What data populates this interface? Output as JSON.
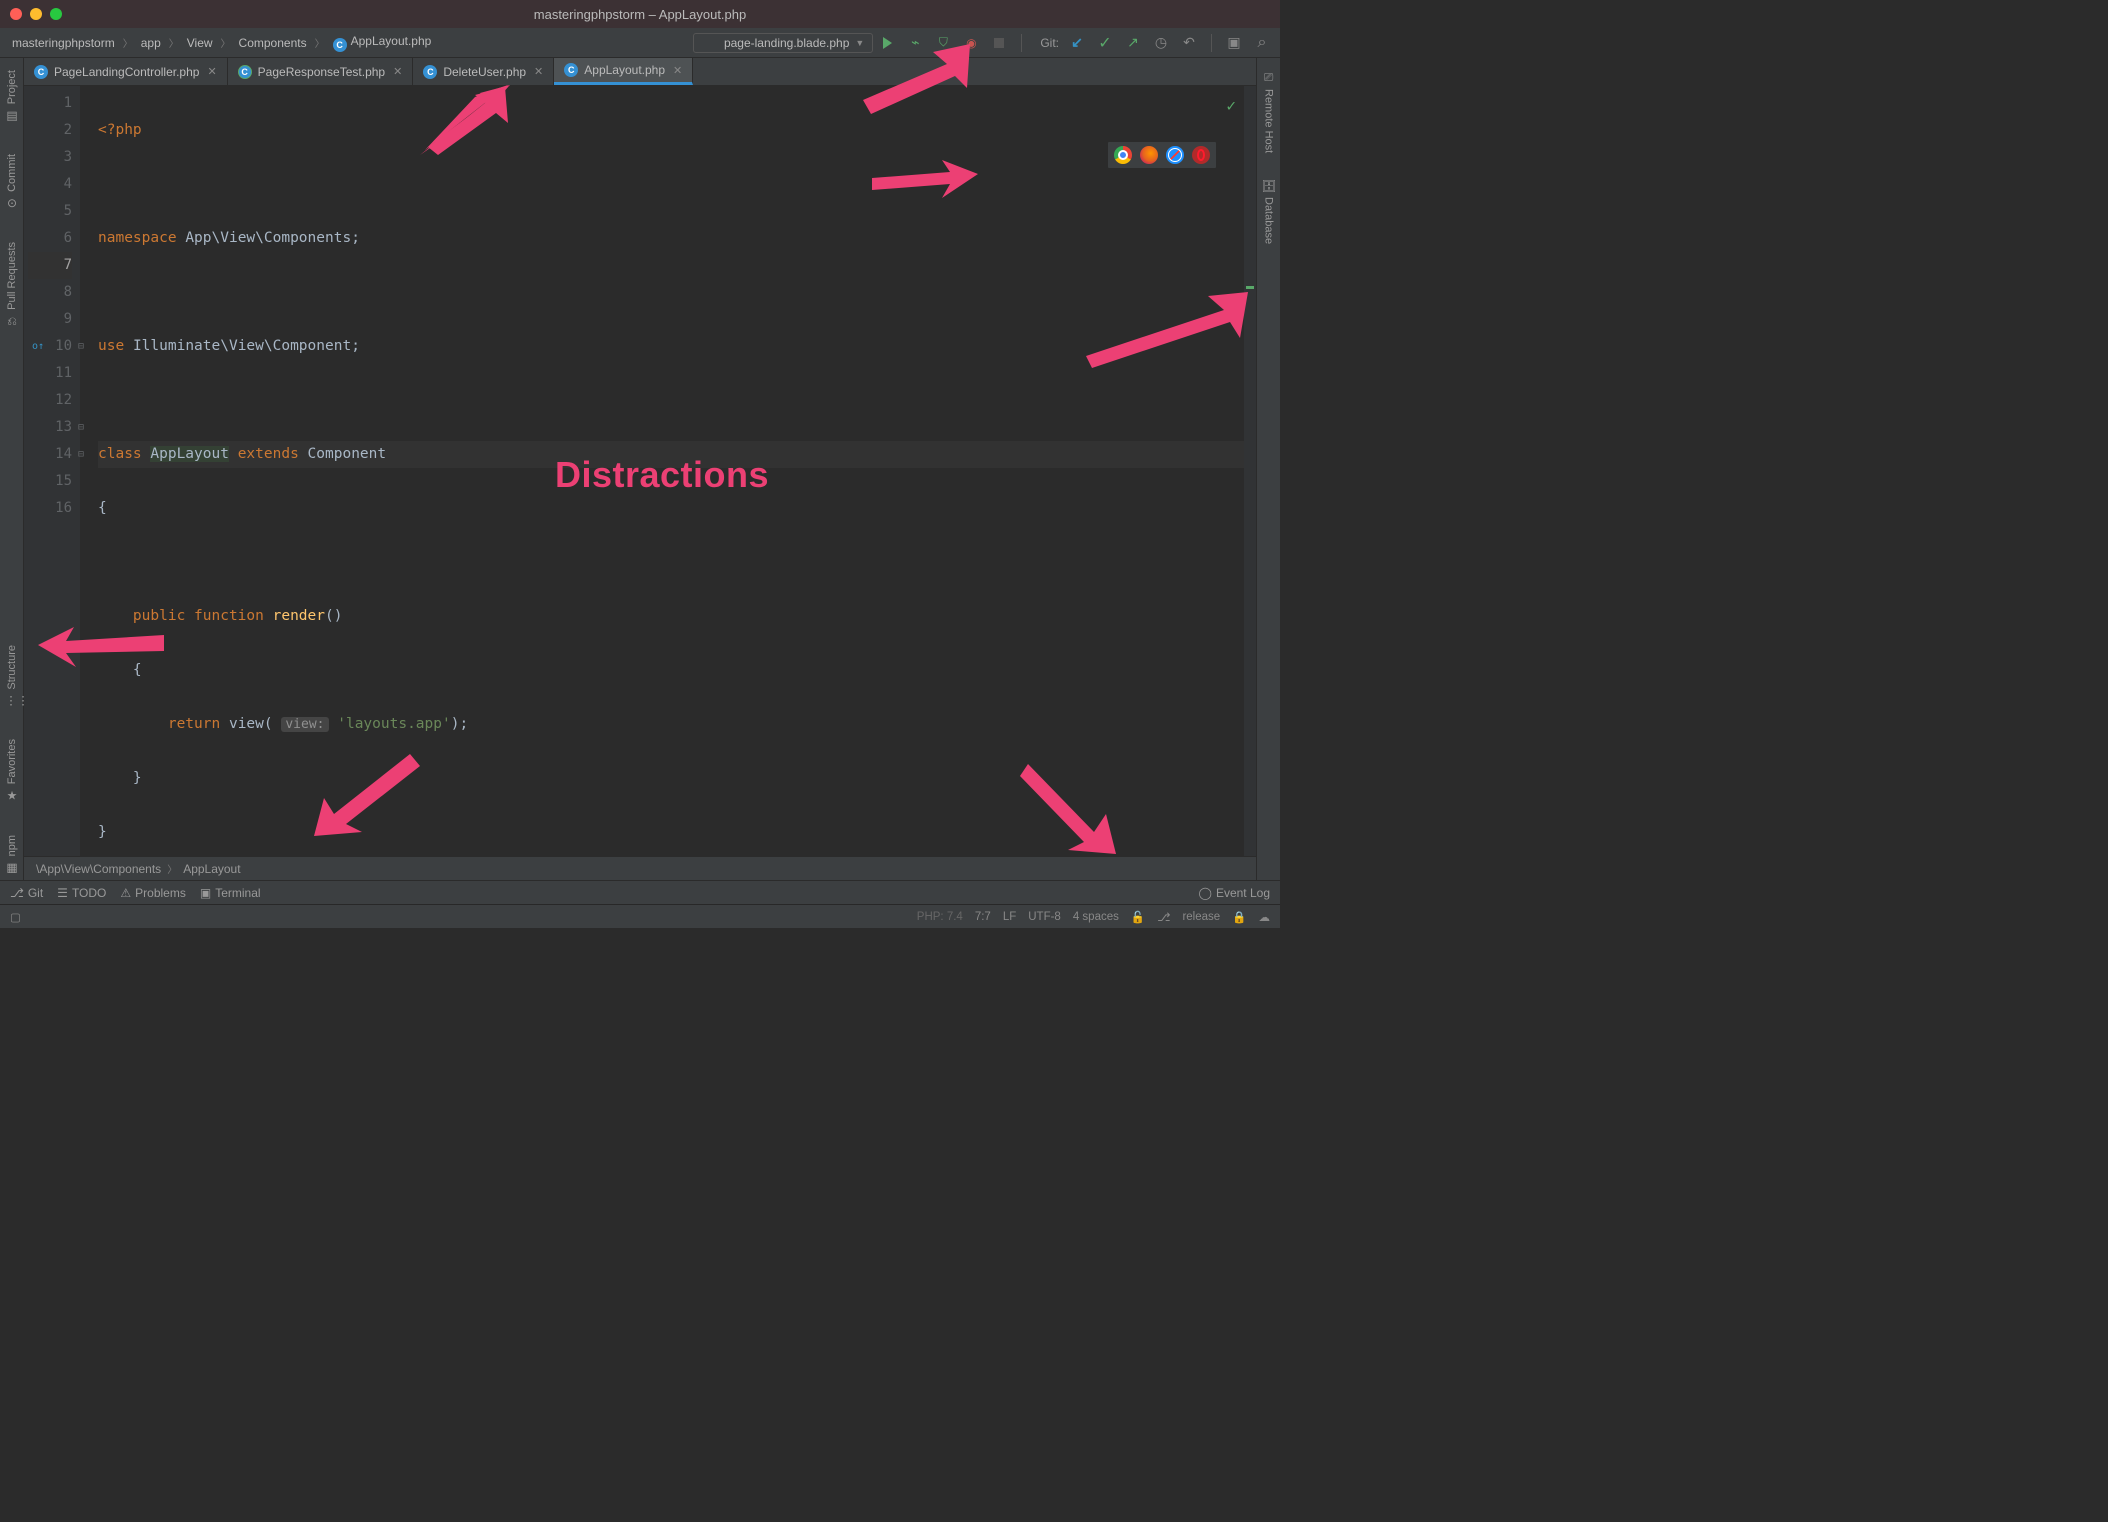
{
  "window": {
    "title": "masteringphpstorm – AppLayout.php"
  },
  "breadcrumbs": {
    "project": "masteringphpstorm",
    "path1": "app",
    "path2": "View",
    "path3": "Components",
    "file": "AppLayout.php"
  },
  "run_config": {
    "selected": "page-landing.blade.php"
  },
  "git_label": "Git:",
  "tabs": [
    {
      "label": "PageLandingController.php",
      "active": false,
      "test": false
    },
    {
      "label": "PageResponseTest.php",
      "active": false,
      "test": true
    },
    {
      "label": "DeleteUser.php",
      "active": false,
      "test": false
    },
    {
      "label": "AppLayout.php",
      "active": true,
      "test": false
    }
  ],
  "left_rail": {
    "project": "Project",
    "commit": "Commit",
    "pull": "Pull Requests",
    "structure": "Structure",
    "favorites": "Favorites",
    "npm": "npm"
  },
  "right_rail": {
    "remote": "Remote Host",
    "database": "Database"
  },
  "code": {
    "l1a": "<?php",
    "l3a": "namespace",
    "l3b": "App\\View\\Components",
    "l3c": ";",
    "l5a": "use",
    "l5b": "Illuminate\\View\\Component",
    "l5c": ";",
    "l7a": "class",
    "l7b": "AppLayout",
    "l7c": "extends",
    "l7d": "Component",
    "l8": "{",
    "l10a": "public function",
    "l10b": "render",
    "l10c": "()",
    "l11": "{",
    "l12a": "return",
    "l12b": "view(",
    "l12hint": "view:",
    "l12c": "'layouts.app'",
    "l12d": ");",
    "l13": "}",
    "l14": "}",
    "line_numbers": [
      "1",
      "2",
      "3",
      "4",
      "5",
      "6",
      "7",
      "8",
      "9",
      "10",
      "11",
      "12",
      "13",
      "14",
      "15",
      "16"
    ]
  },
  "editor_crumb": {
    "a": "\\App\\View\\Components",
    "b": "AppLayout"
  },
  "bottom": {
    "git": "Git",
    "todo": "TODO",
    "problems": "Problems",
    "terminal": "Terminal",
    "event_log": "Event Log"
  },
  "status": {
    "php": "PHP: 7.4",
    "pos": "7:7",
    "le": "LF",
    "enc": "UTF-8",
    "indent": "4 spaces",
    "branch": "release"
  },
  "overlay_text": "Distractions"
}
